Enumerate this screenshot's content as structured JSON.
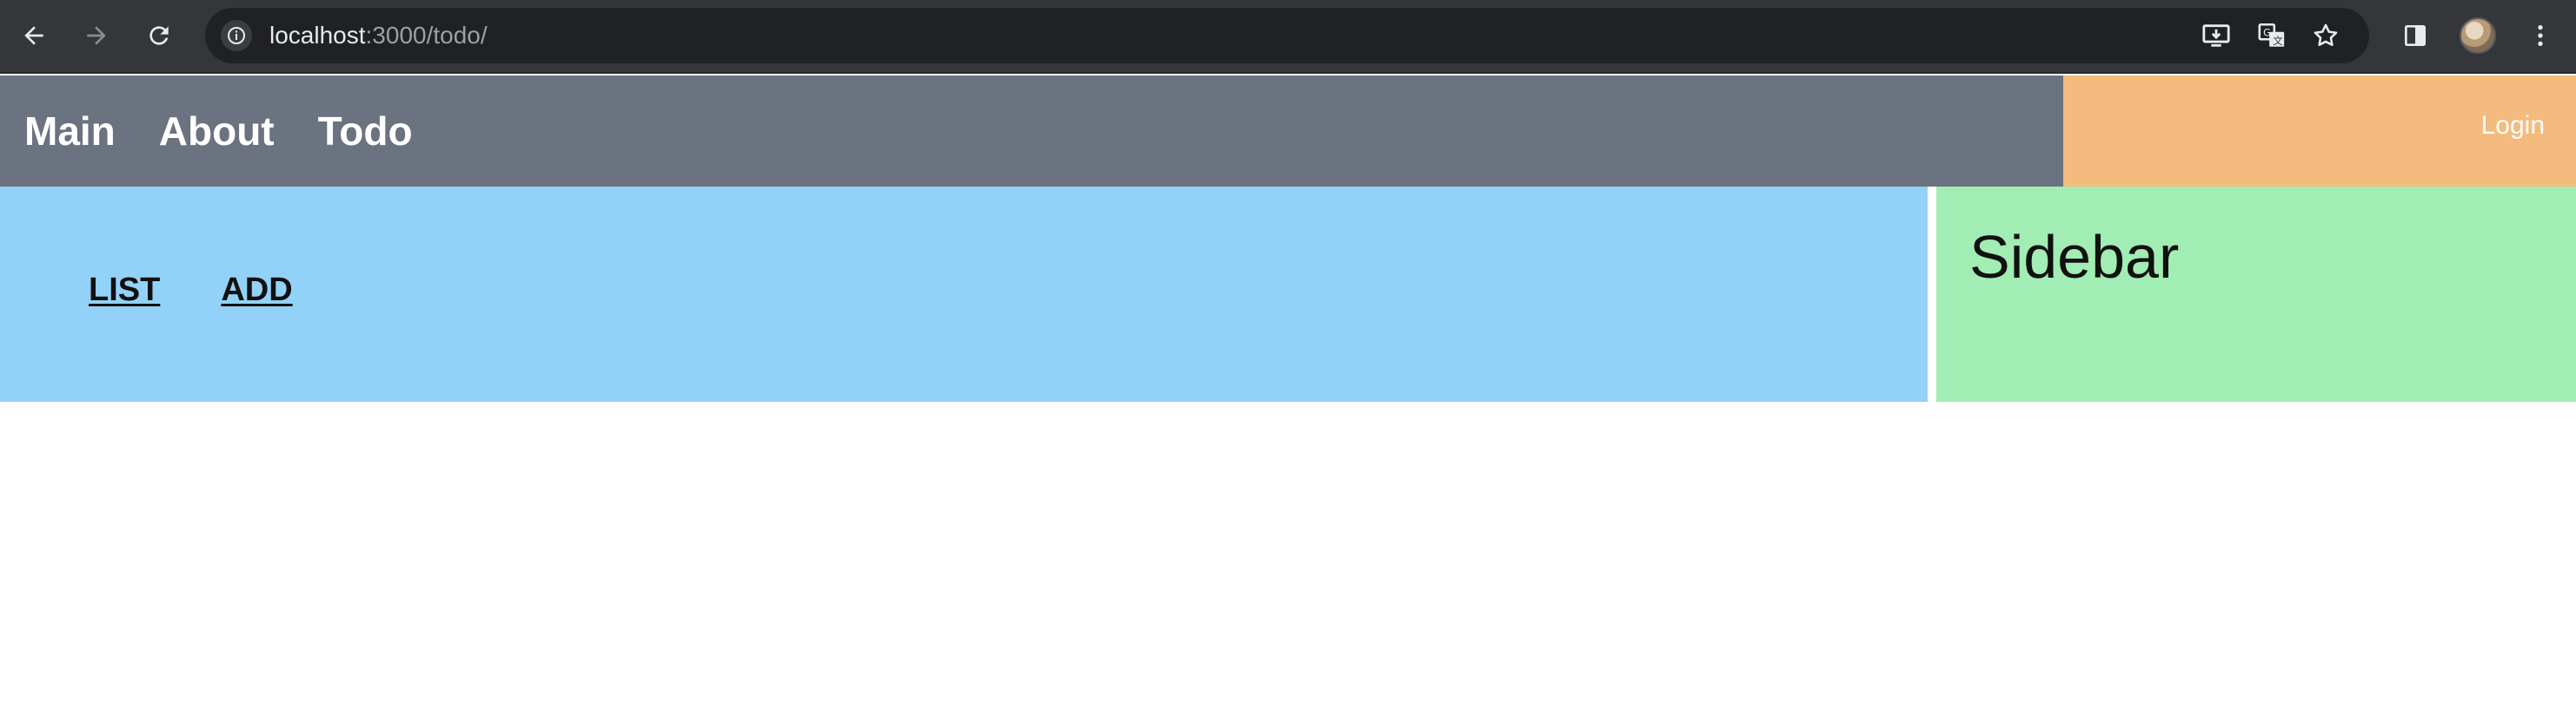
{
  "browser": {
    "url_host": "localhost",
    "url_path": ":3000/todo/",
    "icons": {
      "back": "arrow-left-icon",
      "forward": "arrow-right-icon",
      "reload": "reload-icon",
      "site_info": "info-icon",
      "install": "install-app-icon",
      "translate": "translate-icon",
      "bookmark": "star-icon",
      "side_panel": "side-panel-icon",
      "profile": "avatar",
      "menu": "kebab-menu-icon"
    }
  },
  "header": {
    "nav": [
      "Main",
      "About",
      "Todo"
    ],
    "login_label": "Login"
  },
  "main": {
    "links": [
      "LIST",
      "ADD"
    ]
  },
  "sidebar": {
    "title": "Sidebar"
  },
  "colors": {
    "header_bg": "#6b7280",
    "login_bg": "#f3bb7d",
    "main_bg": "#93d2f8",
    "sidebar_bg": "#a1edb3"
  }
}
